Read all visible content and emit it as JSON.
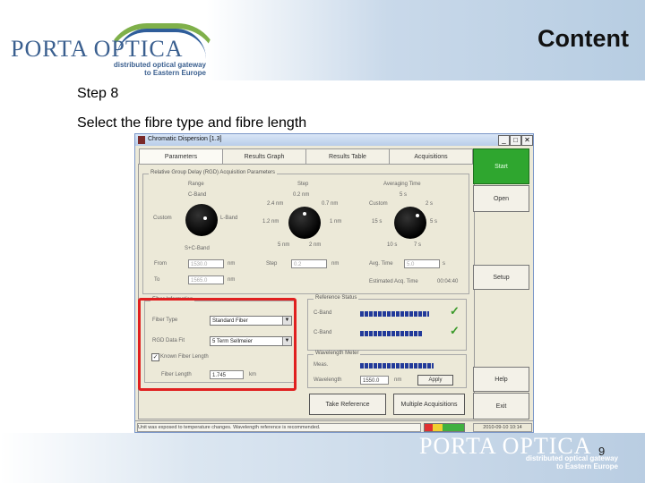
{
  "slide": {
    "logo_text": "PORTA OPTICA",
    "logo_tagline_line1": "distributed optical gateway",
    "logo_tagline_line2": "to Eastern Europe",
    "title": "Content",
    "step": "Step 8",
    "instruction": "Select the fibre type and fibre length",
    "page_number": "9"
  },
  "colors": {
    "brand_blue": "#3a5f8f",
    "start_green": "#2fa62f",
    "highlight_red": "#e02020",
    "bar_blue": "#223a9a"
  },
  "app": {
    "window_title": "Chromatic Dispersion [1.3]",
    "window_buttons": [
      "_",
      "□",
      "✕"
    ],
    "tabs": [
      "Parameters",
      "Results Graph",
      "Results Table",
      "Acquisitions"
    ],
    "active_tab": "Parameters",
    "side_buttons": {
      "start": "Start",
      "open": "Open",
      "setup": "Setup",
      "help": "Help",
      "exit": "Exit"
    },
    "acquisition": {
      "group_label": "Relative Group Delay (RGD) Acquisition Parameters",
      "range_label": "Range",
      "range_top": "C-Band",
      "range_left": "Custom",
      "range_right": "L-Band",
      "range_bottom": "S+C-Band",
      "step_label": "Step",
      "step_top": "0.2 nm",
      "step_tl": "2.4 nm",
      "step_tr": "0.7 nm",
      "step_left": "1.2 nm",
      "step_right": "1 nm",
      "step_bl": "5 nm",
      "step_br": "2 nm",
      "avg_label": "Averaging Time",
      "avg_top": "5 s",
      "avg_tl": "Custom",
      "avg_tr": "2 s",
      "avg_left": "15 s",
      "avg_right": "5 s",
      "avg_bl": "10 s",
      "avg_br": "7 s",
      "from_label": "From",
      "from_value": "1530.0",
      "to_label": "To",
      "to_value": "1565.0",
      "unit_nm": "nm",
      "step_field_label": "Step",
      "step_field_value": "0.2",
      "avg_time_label": "Avg. Time",
      "avg_time_value": "5.0",
      "unit_s": "s",
      "estimated_label": "Estimated Acq. Time",
      "estimated_value": "00:04:40"
    },
    "fiber_info": {
      "group_label": "Fiber Information",
      "fiber_type_label": "Fiber Type",
      "fiber_type_value": "Standard Fiber",
      "rgd_fit_label": "RGD Data Fit",
      "rgd_fit_value": "5 Term Sellmeier",
      "known_length_label": "Known Fiber Length",
      "known_length_checked": true,
      "fiber_length_label": "Fiber Length",
      "fiber_length_value": "1.745",
      "fiber_length_unit": "km"
    },
    "references": {
      "group_label": "Reference Status",
      "ref1_label": "C-Band",
      "ref1_level": 0.9,
      "ref2_label": "C-Band",
      "ref2_level": 0.8
    },
    "wavelength_meter": {
      "group_label": "Wavelength Meter",
      "meas_label": "Meas.",
      "meas_level": 0.95,
      "wavelength_label": "Wavelength",
      "wavelength_value": "1550.0",
      "wavelength_unit": "nm",
      "apply_label": "Apply"
    },
    "take_reference_button": "Take Reference",
    "multiple_acquisitions_button": "Multiple Acquisitions",
    "status_message": "Unit was exposed to temperature changes. Wavelength reference is recommended.",
    "status_timestamp": "2010-09-10 10:14"
  }
}
